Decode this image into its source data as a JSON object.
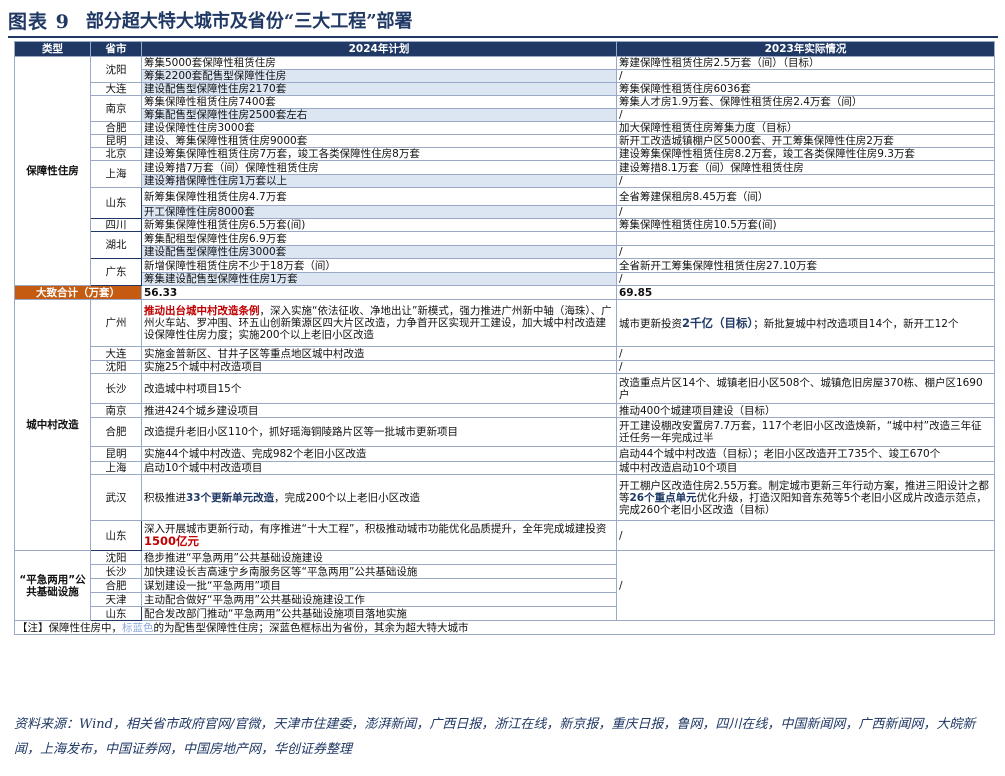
{
  "title": {
    "num": "图表 9",
    "text": "部分超大特大城市及省份“三大工程”部署"
  },
  "headers": {
    "type": "类型",
    "city": "省市",
    "plan": "2024年计划",
    "actual": "2023年实际情况"
  },
  "cat1": {
    "name": "保障性住房",
    "rows": [
      {
        "city": "沈阳",
        "plan": "筹集5000套保障性租赁住房",
        "actual": "筹建保障性租赁住房2.5万套（间）（目标）"
      },
      {
        "plan": "筹集2200套配售型保障性住房",
        "actual": "/"
      },
      {
        "city": "大连",
        "plan": "建设配售型保障性住房2170套",
        "actual": "筹集保障性租赁住房6036套"
      },
      {
        "city": "南京",
        "plan": "筹集保障性租赁住房7400套",
        "actual": "筹集人才房1.9万套、保障性租赁住房2.4万套（间）"
      },
      {
        "plan": "筹集配售型保障性住房2500套左右",
        "actual": "/"
      },
      {
        "city": "合肥",
        "plan": "建设保障性住房3000套",
        "actual": "加大保障性租赁住房筹集力度（目标）"
      },
      {
        "city": "昆明",
        "plan": "建设、筹集保障性租赁住房9000套",
        "actual": "新开工改造城镇棚户区5000套、开工筹集保障性住房2万套"
      },
      {
        "city": "北京",
        "plan": "建设筹集保障性租赁住房7万套，竣工各类保障性住房8万套",
        "actual": "建设筹集保障性租赁住房8.2万套，竣工各类保障性住房9.3万套"
      },
      {
        "city": "上海",
        "plan": "建设筹措7万套（间）保障性租赁住房",
        "actual": "建设筹措8.1万套（间）保障性租赁住房"
      },
      {
        "plan": "建设筹措保障性住房1万套以上",
        "actual": "/"
      },
      {
        "city": "山东",
        "plan": "新筹集保障性租赁住房4.7万套",
        "actual": "全省筹建保租房8.45万套（间）"
      },
      {
        "plan": "开工保障性住房8000套",
        "actual": "/"
      },
      {
        "city": "四川",
        "plan": "新筹集保障性租赁住房6.5万套(间)",
        "actual": "筹集保障性租赁住房10.5万套(间)"
      },
      {
        "city": "湖北",
        "plan": "筹集配租型保障性住房6.9万套",
        "actual": ""
      },
      {
        "plan": "建设配售型保障性住房3000套",
        "actual": "/"
      },
      {
        "city": "广东",
        "plan": "新增保障性租赁住房不少于18万套（间）",
        "actual": "全省新开工筹集保障性租赁住房27.10万套"
      },
      {
        "plan": "筹集建设配售型保障性住房1万套",
        "actual": "/"
      }
    ]
  },
  "total": {
    "label": "大致合计（万套）",
    "plan": "56.33",
    "actual": "69.85"
  },
  "cat2": {
    "name": "城中村改造",
    "rows": [
      {
        "city": "广州",
        "plan_hl": "推动出台城中村改造条例",
        "plan": "，深入实施“依法征收、净地出让”新模式，强力推进广州新中轴（海珠）、广州火车站、罗冲围、环五山创新策源区四大片区改造，力争首开区实现开工建设，加大城中村改造建设保障性住房力度；实施200个以上老旧小区改造",
        "actual_a": "城市更新投资",
        "actual_hl": "2千亿（目标）",
        "actual_b": "；新批复城中村改造项目14个，新开工12个"
      },
      {
        "city": "大连",
        "plan": "实施金普新区、甘井子区等重点地区城中村改造",
        "actual": "/"
      },
      {
        "city": "沈阳",
        "plan": "实施25个城中村改造项目",
        "actual": "/"
      },
      {
        "city": "长沙",
        "plan": "改造城中村项目15个",
        "actual": "改造重点片区14个、城镇老旧小区508个、城镇危旧房屋370栋、棚户区1690户"
      },
      {
        "city": "南京",
        "plan": "推进424个城乡建设项目",
        "actual": "推动400个城建项目建设（目标）"
      },
      {
        "city": "合肥",
        "plan": "改造提升老旧小区110个，抓好瑶海铜陵路片区等一批城市更新项目",
        "actual": "开工建设棚改安置房7.7万套，117个老旧小区改造焕新，“城中村”改造三年征迁任务一年完成过半"
      },
      {
        "city": "昆明",
        "plan": "实施44个城中村改造、完成982个老旧小区改造",
        "actual": "启动44个城中村改造（目标）；老旧小区改造开工735个、竣工670个"
      },
      {
        "city": "上海",
        "plan": "启动10个城中村改造项目",
        "actual": "城中村改造启动10个项目"
      },
      {
        "city": "武汉",
        "plan_a": "积极推进",
        "plan_hl": "33个更新单元改造",
        "plan_b": "，完成200个以上老旧小区改造",
        "actual_a": "开工棚户区改造住房2.55万套。制定城市更新三年行动方案，推进三阳设计之都等",
        "actual_hl": "26个重点单元",
        "actual_b": "优化升级，打造汉阳知音东苑等5个老旧小区成片改造示范点，完成260个老旧小区改造（目标）"
      },
      {
        "city": "山东",
        "plan_a": "深入开展城市更新行动，有序推进“十大工程”，积极推动城市功能优化品质提升，全年完成城建投资",
        "plan_hl": "1500亿元",
        "actual": "/"
      }
    ]
  },
  "cat3": {
    "name": "“平急两用”公共基础设施",
    "rows": [
      {
        "city": "沈阳",
        "plan": "稳步推进“平急两用”公共基础设施建设"
      },
      {
        "city": "长沙",
        "plan": "加快建设长吉高速宁乡南服务区等“平急两用”公共基础设施"
      },
      {
        "city": "合肥",
        "plan": "谋划建设一批“平急两用”项目"
      },
      {
        "city": "天津",
        "plan": "主动配合做好“平急两用”公共基础设施建设工作"
      },
      {
        "city": "山东",
        "plan": "配合发改部门推动“平急两用”公共基础设施项目落地实施"
      }
    ],
    "actual": "/"
  },
  "note": {
    "prefix": "【注】保障性住房中，",
    "lb": "标蓝色",
    "rest": "的为配售型保障性住房；深蓝色框标出为省份，其余为超大特大城市"
  },
  "source": "资料来源：Wind，相关省市政府官网/官微，天津市住建委，澎湃新闻，广西日报，浙江在线，新京报，重庆日报，鲁网，四川在线，中国新闻网，广西新闻网，大皖新闻，上海发布，中国证券网，中国房地产网，华创证券整理",
  "colors": {
    "header": "#1f3864",
    "light_blue": "#dce6f2",
    "total": "#c55a11",
    "highlight": "#c00000"
  }
}
